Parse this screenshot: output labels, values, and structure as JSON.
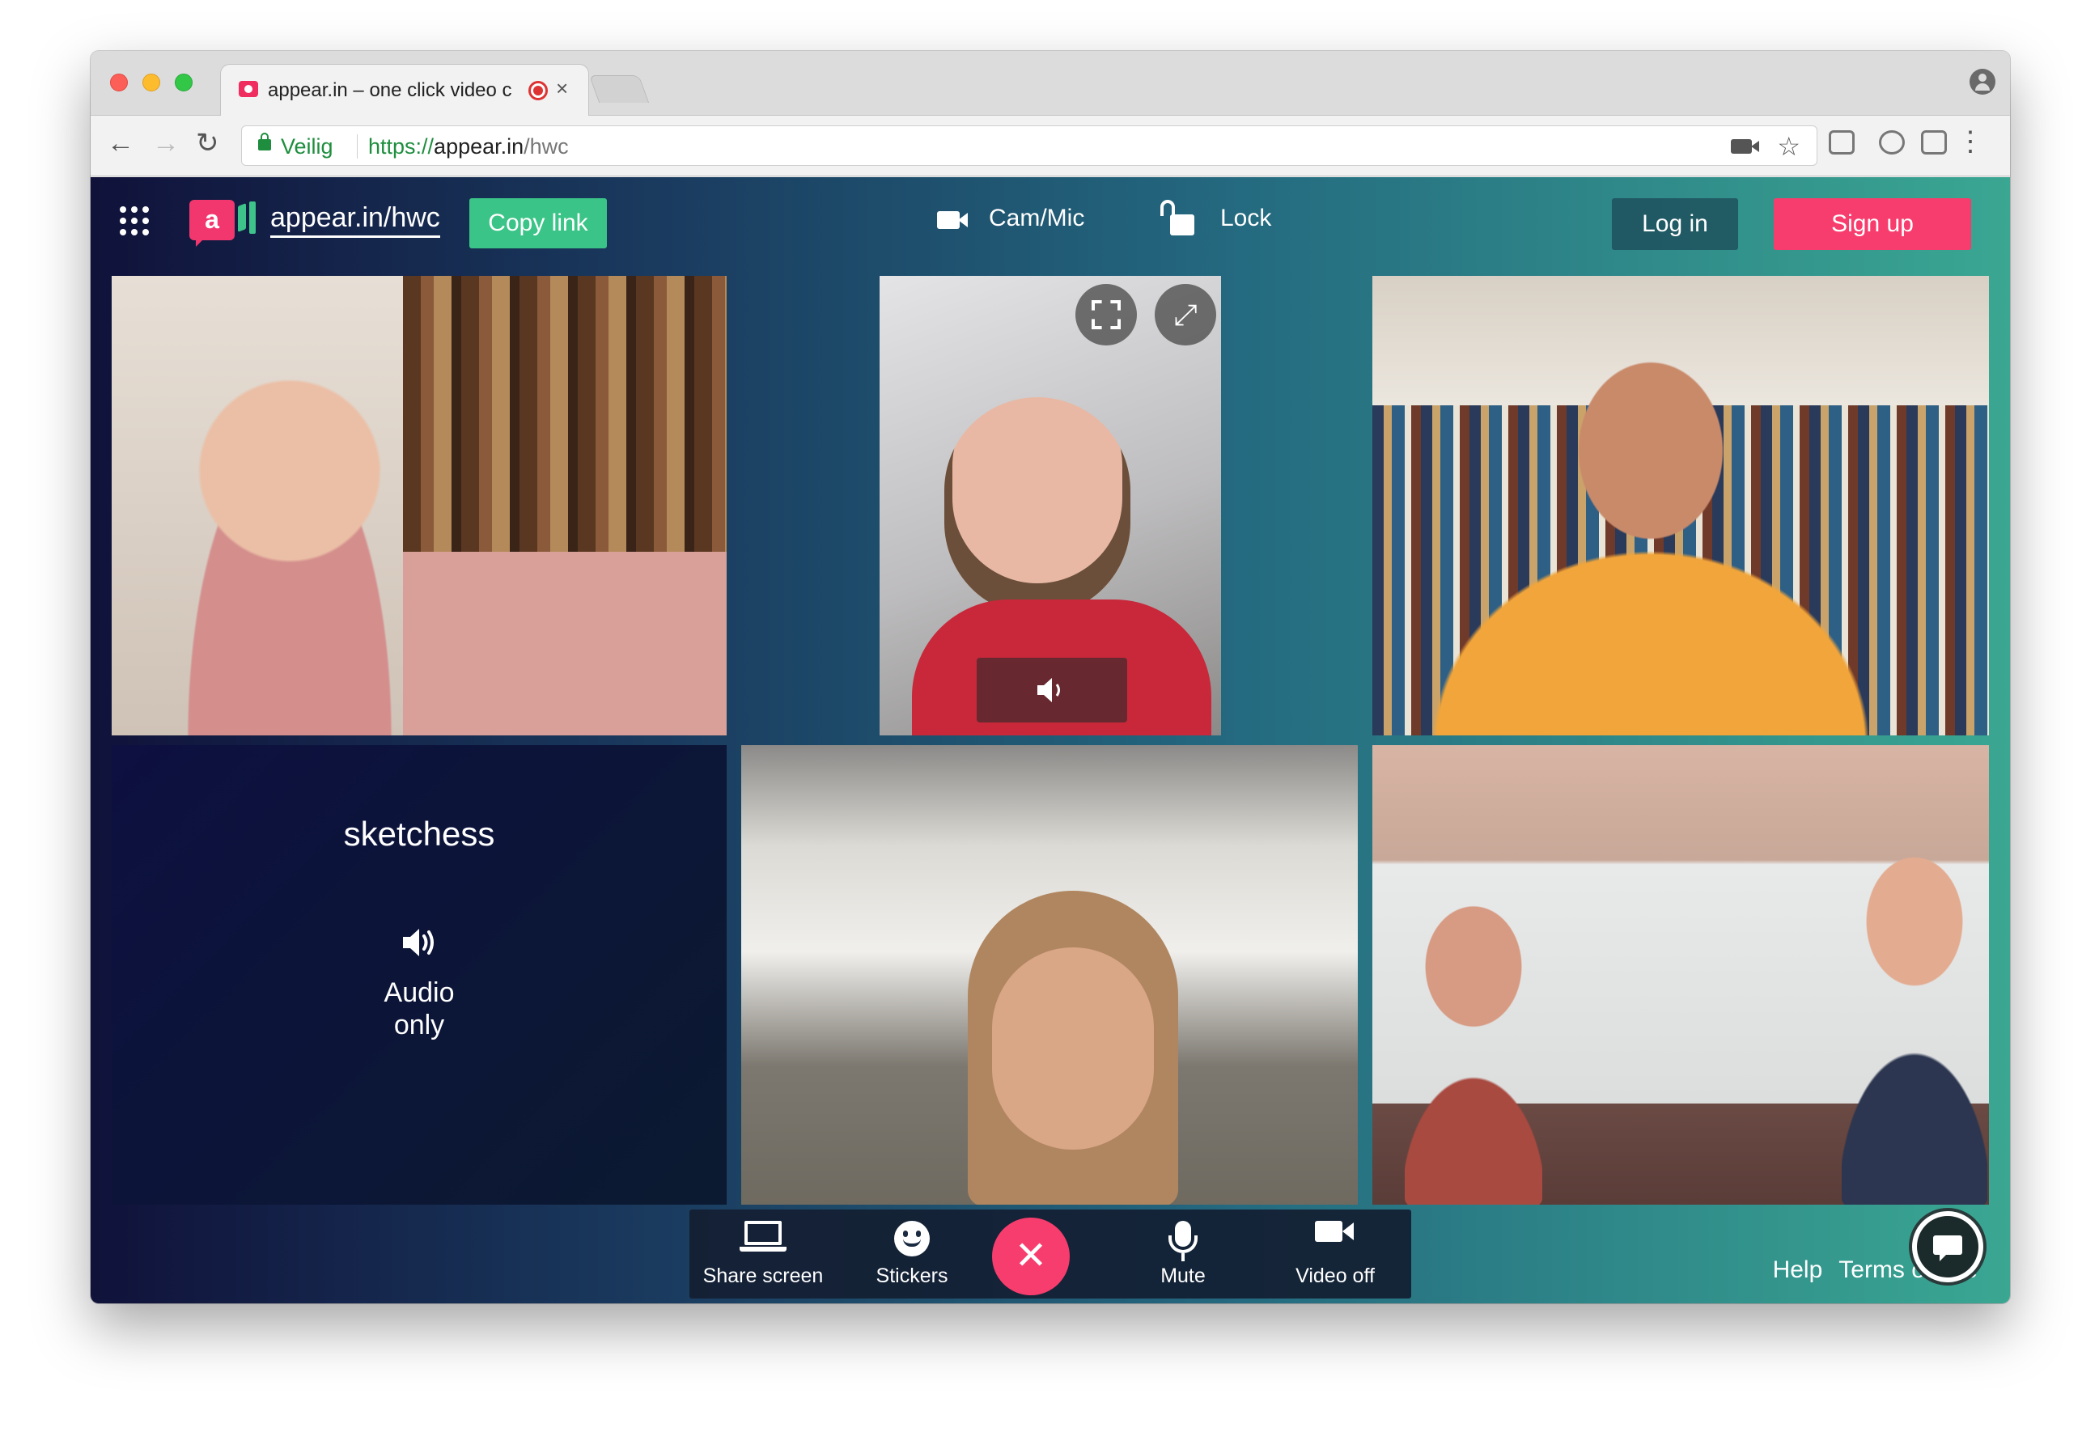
{
  "browser": {
    "tab_title": "appear.in – one click video c",
    "tab_close": "×",
    "nav_back": "←",
    "nav_forward": "→",
    "nav_reload": "↻",
    "secure_label": "Veilig",
    "url_scheme": "https://",
    "url_host": "appear.in",
    "url_path": "/hwc",
    "bookmark_star": "☆",
    "menu": "⋮"
  },
  "app": {
    "room_name": "appear.in/hwc",
    "logo_letter": "a",
    "copy_link_label": "Copy link",
    "cam_mic_label": "Cam/Mic",
    "lock_label": "Lock",
    "login_label": "Log in",
    "signup_label": "Sign up",
    "colors": {
      "brand_pink": "#f73d6d",
      "brand_green": "#3bc487",
      "gradient_start": "#10123a",
      "gradient_end": "#3aa792"
    }
  },
  "tiles": {
    "audio_only": {
      "name": "sketchess",
      "label": "Audio only",
      "icon": "speaker-icon"
    },
    "self_view": {
      "fullscreen_icon": "fullscreen-icon",
      "expand_icon": "expand-icon",
      "expand_glyph": "⤢",
      "volume_icon": "speaker-icon"
    }
  },
  "controls": {
    "share_screen": "Share screen",
    "stickers": "Stickers",
    "hangup_glyph": "✕",
    "mute": "Mute",
    "video_off": "Video off"
  },
  "footer": {
    "help": "Help",
    "terms": "Terms of use"
  }
}
